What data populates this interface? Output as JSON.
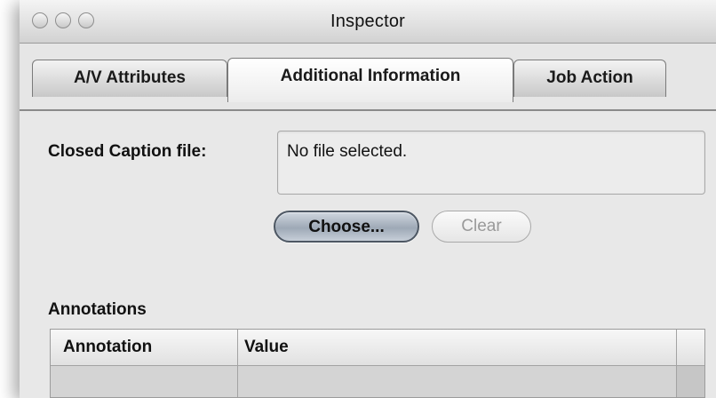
{
  "window": {
    "title": "Inspector"
  },
  "tabs": [
    {
      "label": "A/V Attributes",
      "active": false
    },
    {
      "label": "Additional Information",
      "active": true
    },
    {
      "label": "Job Action",
      "active": false
    }
  ],
  "closed_caption": {
    "label": "Closed Caption file:",
    "value": "No file selected.",
    "choose_label": "Choose...",
    "clear_label": "Clear"
  },
  "annotations": {
    "title": "Annotations",
    "columns": [
      "Annotation",
      "Value"
    ],
    "rows": []
  }
}
